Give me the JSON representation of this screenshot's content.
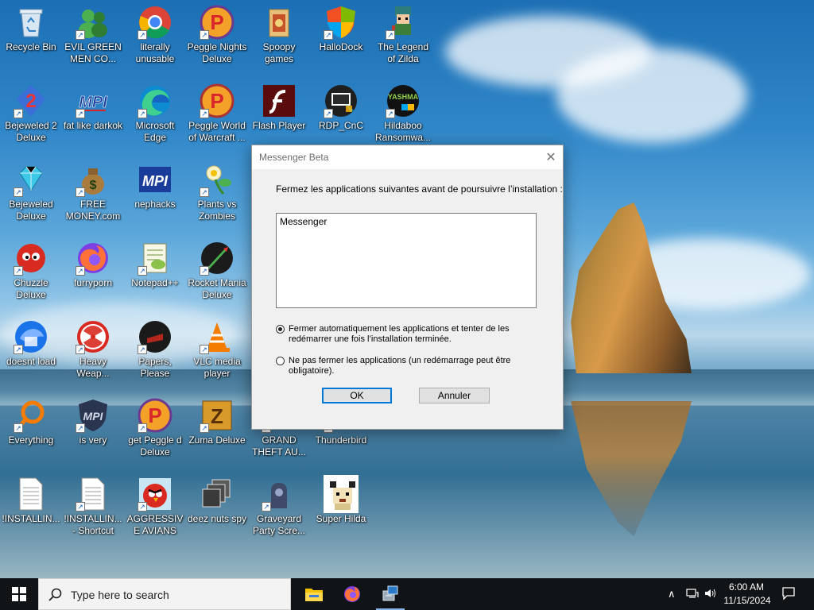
{
  "desktop": {
    "icons": [
      {
        "label": "Recycle Bin",
        "icon": "recycle-bin-icon"
      },
      {
        "label": "EVIL GREEN MEN CO...",
        "icon": "msn-buddies-icon"
      },
      {
        "label": "literally unusable",
        "icon": "chrome-icon"
      },
      {
        "label": "Peggle Nights Deluxe",
        "icon": "peggle-icon"
      },
      {
        "label": "Spoopy games",
        "icon": "folder-icon"
      },
      {
        "label": "HalloDock",
        "icon": "shield-icon"
      },
      {
        "label": "The Legend of Zilda",
        "icon": "pixel-character-icon"
      },
      {
        "label": "Bejeweled 2 Deluxe",
        "icon": "bejeweled2-icon"
      },
      {
        "label": "fat like darkok",
        "icon": "mpi-icon"
      },
      {
        "label": "Microsoft Edge",
        "icon": "edge-icon"
      },
      {
        "label": "Peggle World of Warcraft ...",
        "icon": "peggle-icon"
      },
      {
        "label": "Flash Player",
        "icon": "flash-icon"
      },
      {
        "label": "RDP_CnC",
        "icon": "rdp-icon"
      },
      {
        "label": "Hildaboo Ransomwa...",
        "icon": "yashma-icon"
      },
      {
        "label": "Bejeweled Deluxe",
        "icon": "diamond-icon"
      },
      {
        "label": "FREE MONEY.com",
        "icon": "money-bag-icon"
      },
      {
        "label": "nephacks",
        "icon": "mpi-icon"
      },
      {
        "label": "Plants vs Zombies",
        "icon": "flower-icon"
      },
      {
        "label": "Chuzzle Deluxe",
        "icon": "chuzzle-icon"
      },
      {
        "label": "furryporn",
        "icon": "firefox-icon"
      },
      {
        "label": "Notepad++",
        "icon": "notepadpp-icon"
      },
      {
        "label": "Rocket Mania Deluxe",
        "icon": "rocket-icon"
      },
      {
        "label": "doesnt load",
        "icon": "thunderbird-icon"
      },
      {
        "label": "Heavy Weap...",
        "icon": "radiation-icon"
      },
      {
        "label": "Papers, Please",
        "icon": "papers-please-icon"
      },
      {
        "label": "VLC media player",
        "icon": "vlc-icon"
      },
      {
        "label": "Everything",
        "icon": "everything-search-icon"
      },
      {
        "label": "is very",
        "icon": "mpi-shield-icon"
      },
      {
        "label": "get Peggle d Deluxe",
        "icon": "peggle-icon"
      },
      {
        "label": "Zuma Deluxe",
        "icon": "zuma-icon"
      },
      {
        "label": "GRAND THEFT AU...",
        "icon": "gta-icon"
      },
      {
        "label": "Thunderbird",
        "icon": "thunderbird-icon"
      },
      {
        "label": "!INSTALLIN...",
        "icon": "text-file-icon"
      },
      {
        "label": "!INSTALLIN... - Shortcut",
        "icon": "text-file-icon"
      },
      {
        "label": "AGGRESSIVE AVIANS",
        "icon": "angry-bird-icon"
      },
      {
        "label": "deez nuts spy",
        "icon": "stacked-windows-icon"
      },
      {
        "label": "Graveyard Party Scre...",
        "icon": "graveyard-icon"
      },
      {
        "label": "Super Hilda",
        "icon": "pixel-dog-icon"
      }
    ]
  },
  "dialog": {
    "title": "Messenger Beta",
    "message": "Fermez les applications suivantes avant de poursuivre l’installation :",
    "apps": [
      "Messenger"
    ],
    "option_close": "Fermer automatiquement les applications et tenter de les redémarrer une fois l’installation terminée.",
    "option_keep": "Ne pas fermer les applications (un redémarrage peut être obligatoire).",
    "selected_option": "close",
    "ok_label": "OK",
    "cancel_label": "Annuler"
  },
  "taskbar": {
    "search_placeholder": "Type here to search",
    "apps": [
      "file-explorer-icon",
      "firefox-icon",
      "installer-icon"
    ],
    "time": "6:00 AM",
    "date": "11/15/2024"
  },
  "colors": {
    "accent": "#0078d7",
    "taskbar": "#101417"
  }
}
